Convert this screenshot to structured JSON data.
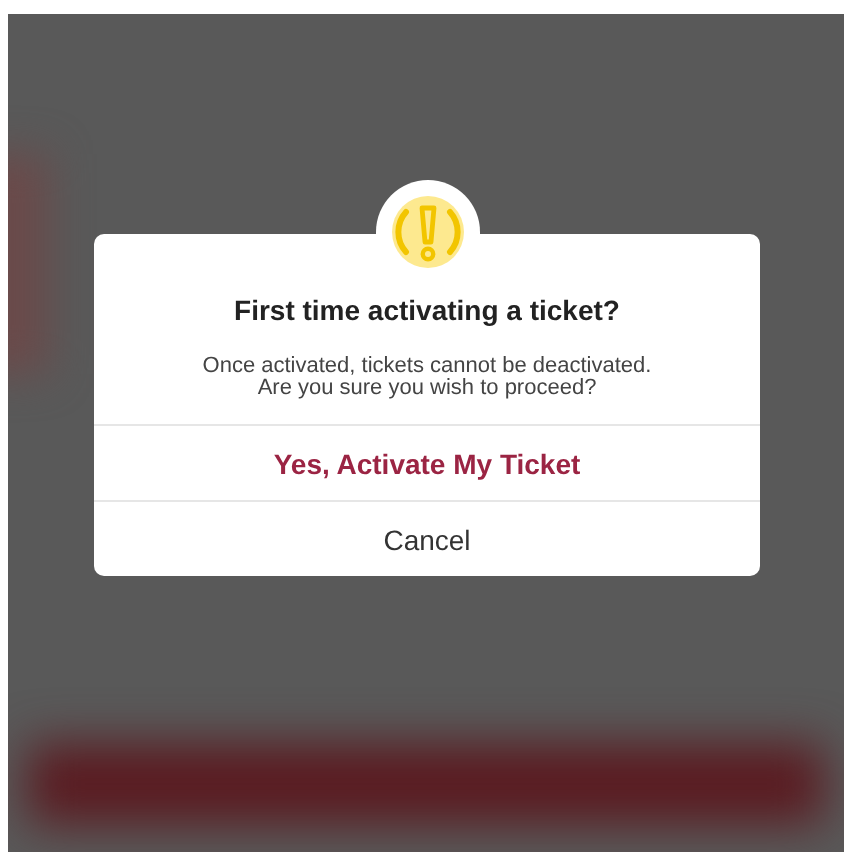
{
  "dialog": {
    "title": "First time activating a ticket?",
    "message": "Once activated, tickets cannot be deactivated. Are you sure you wish to proceed?",
    "buttons": [
      {
        "label": "Yes, Activate My Ticket",
        "kind": "primary"
      },
      {
        "label": "Cancel",
        "kind": "cancel"
      }
    ]
  }
}
